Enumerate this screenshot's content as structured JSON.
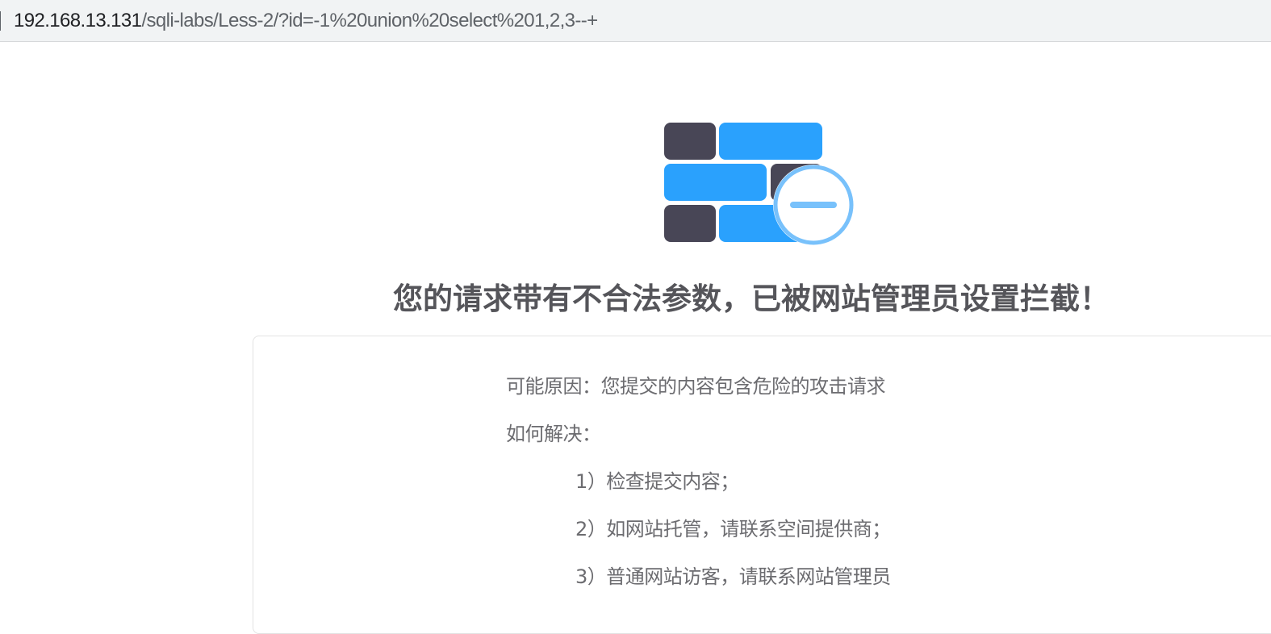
{
  "browser": {
    "url_host": "192.168.13.131",
    "url_path": "/sqli-labs/Less-2/?id=-1%20union%20select%201,2,3--+"
  },
  "block_page": {
    "headline": "您的请求带有不合法参数，已被网站管理员设置拦截！",
    "reason": "可能原因：您提交的内容包含危险的攻击请求",
    "solution_label": "如何解决：",
    "steps": [
      "1）检查提交内容；",
      "2）如网站托管，请联系空间提供商；",
      "3）普通网站访客，请联系网站管理员"
    ]
  },
  "colors": {
    "brick_dark": "#484656",
    "brick_blue": "#2aa1fd",
    "badge_ring": "#78c1fb",
    "headline": "#55555a",
    "body_text": "#6c6c70"
  },
  "icons": {
    "wall": "firewall-block-icon",
    "badge": "minus-circle-icon"
  }
}
